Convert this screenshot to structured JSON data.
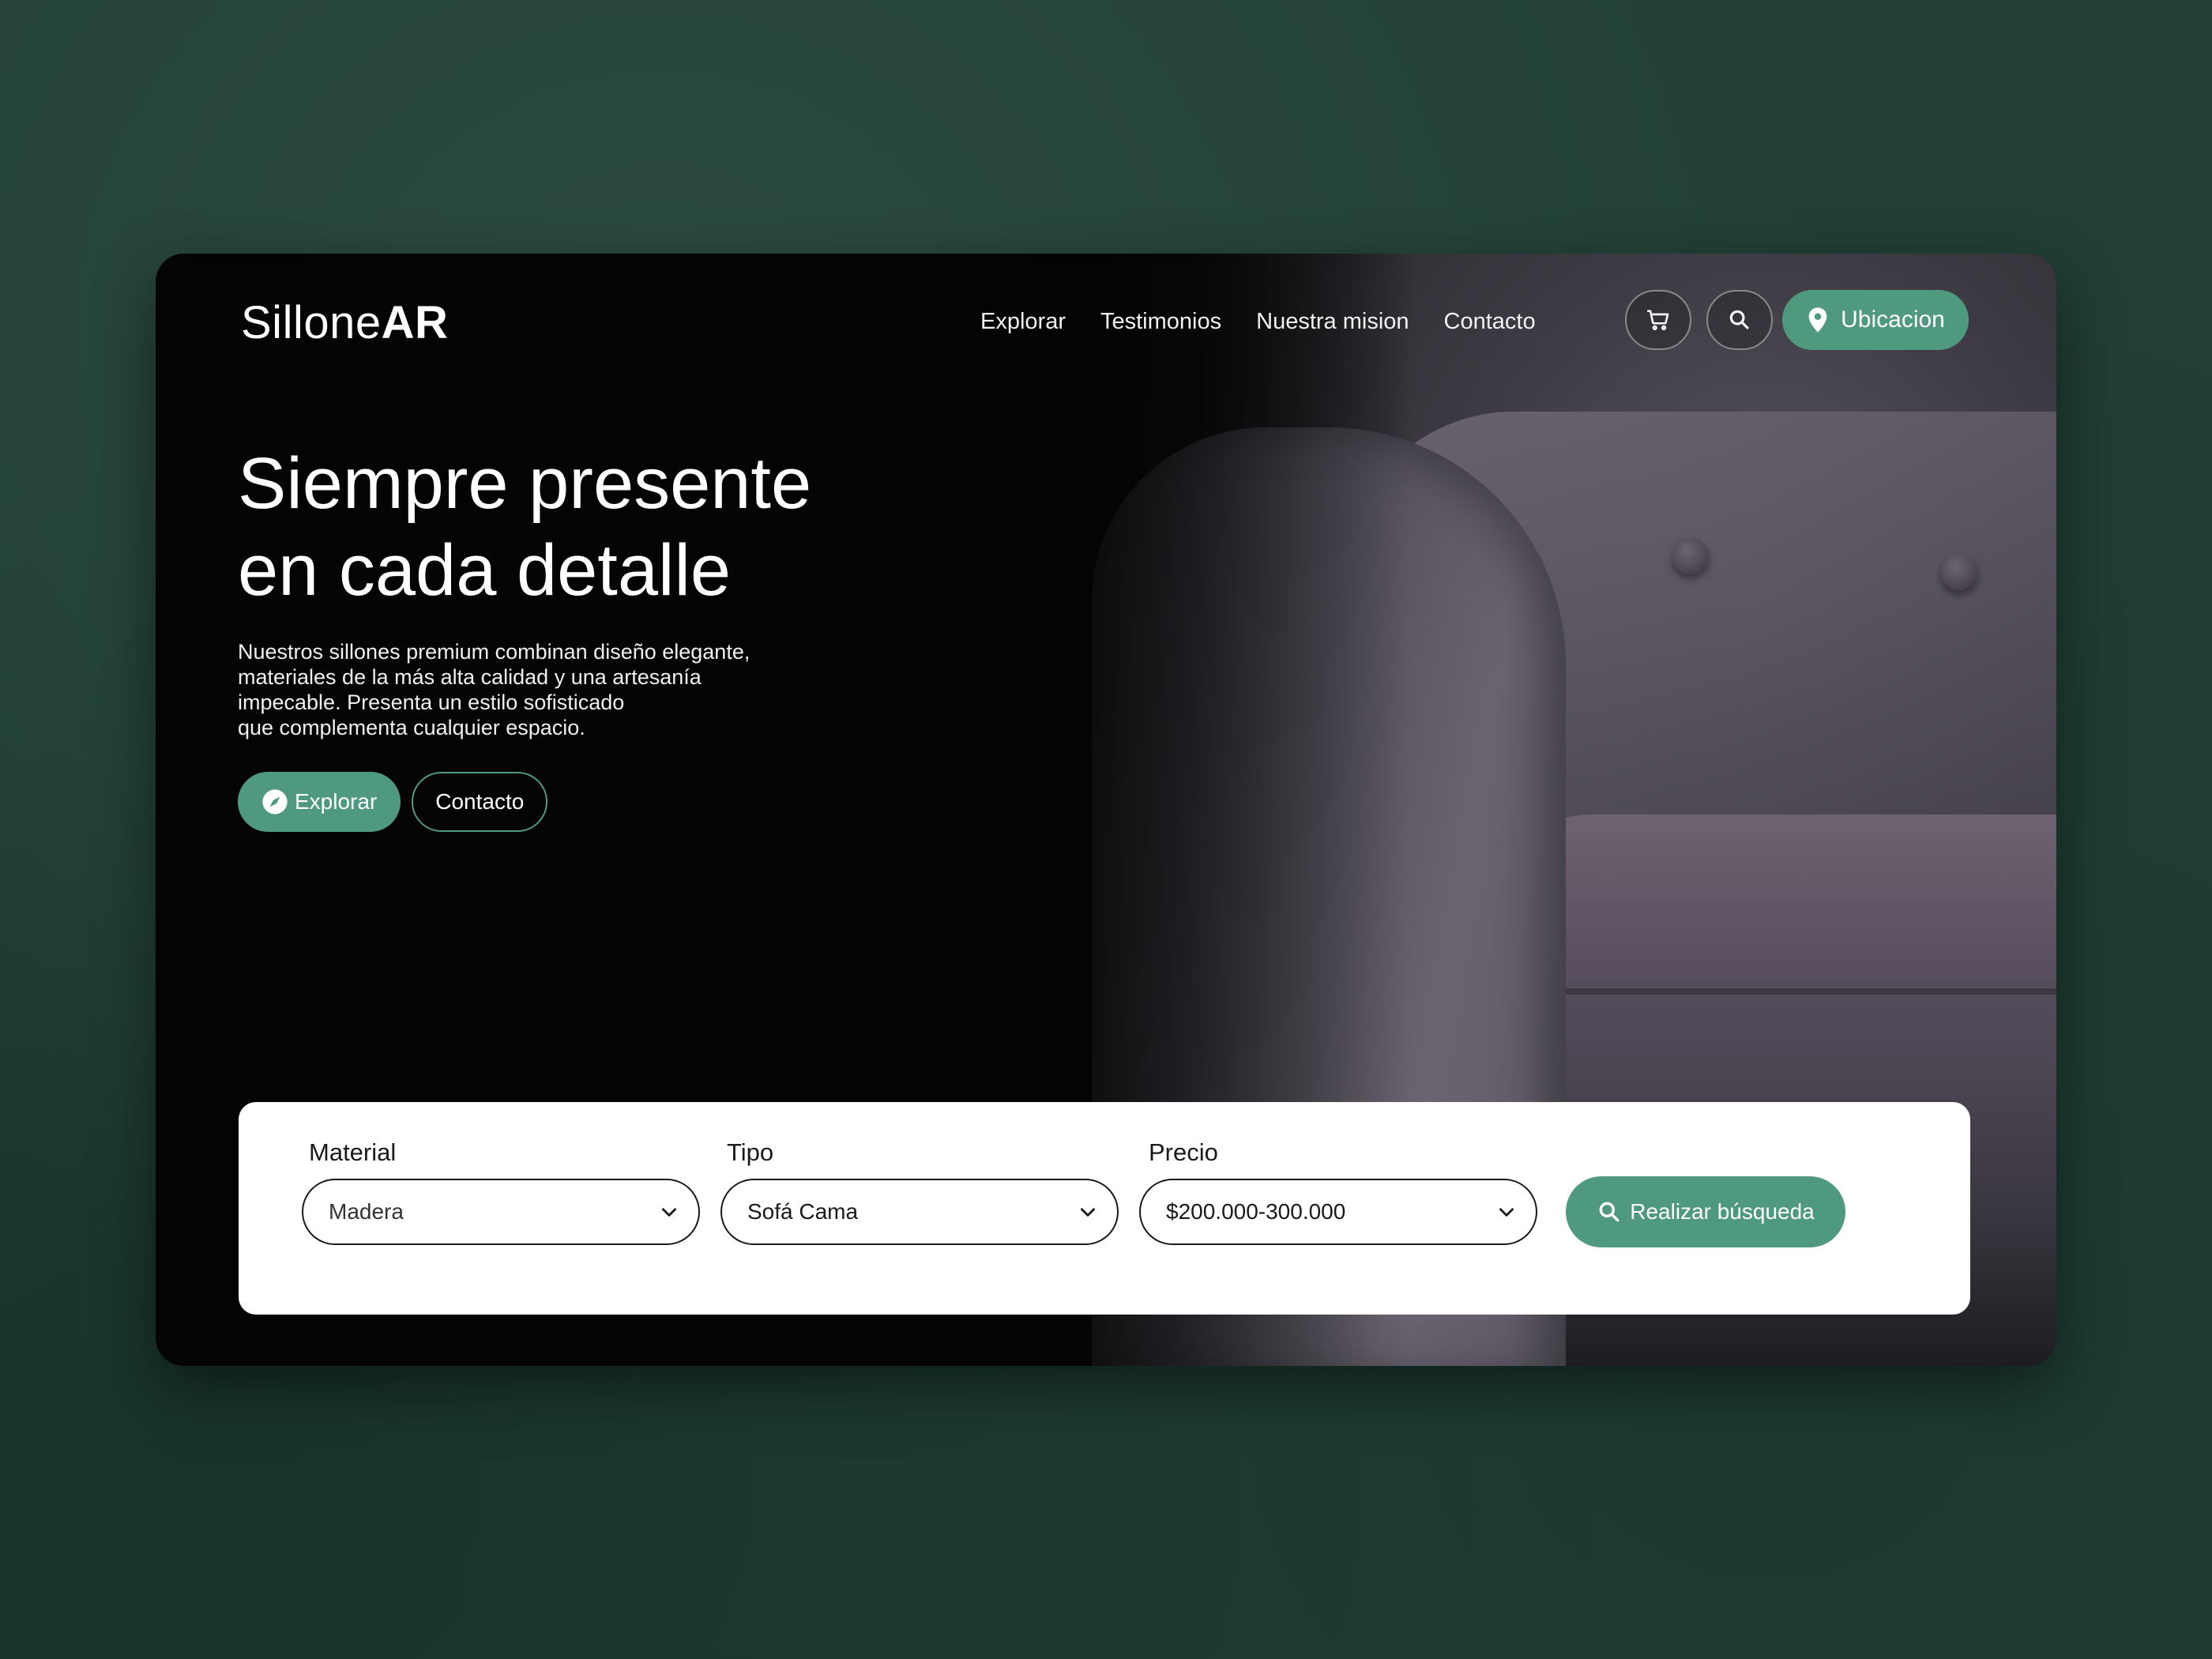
{
  "brand": {
    "logo_regular": "Sillone",
    "logo_bold": "AR"
  },
  "nav": {
    "items": [
      "Explorar",
      "Testimonios",
      "Nuestra mision",
      "Contacto"
    ]
  },
  "header_actions": {
    "cart_icon": "cart-icon",
    "search_icon": "search-icon",
    "location_label": "Ubicacion",
    "location_icon": "map-pin-icon"
  },
  "hero": {
    "title_line1": "Siempre presente",
    "title_line2": "en cada detalle",
    "description_lines": [
      "Nuestros sillones premium combinan diseño elegante,",
      "materiales de la más alta calidad y una artesanía",
      "impecable. Presenta un estilo sofisticado",
      "que complementa cualquier espacio."
    ],
    "primary_cta": "Explorar",
    "primary_cta_icon": "compass-icon",
    "secondary_cta": "Contacto"
  },
  "search": {
    "fields": [
      {
        "label": "Material",
        "value": "Madera"
      },
      {
        "label": "Tipo",
        "value": "Sofá Cama"
      },
      {
        "label": "Precio",
        "value": "$200.000-300.000"
      }
    ],
    "button_label": "Realizar búsqueda",
    "button_icon": "search-icon"
  },
  "colors": {
    "accent": "#4f9a7e",
    "background": "#213f35",
    "hero_bg": "#040404",
    "panel_bg": "#ffffff"
  }
}
